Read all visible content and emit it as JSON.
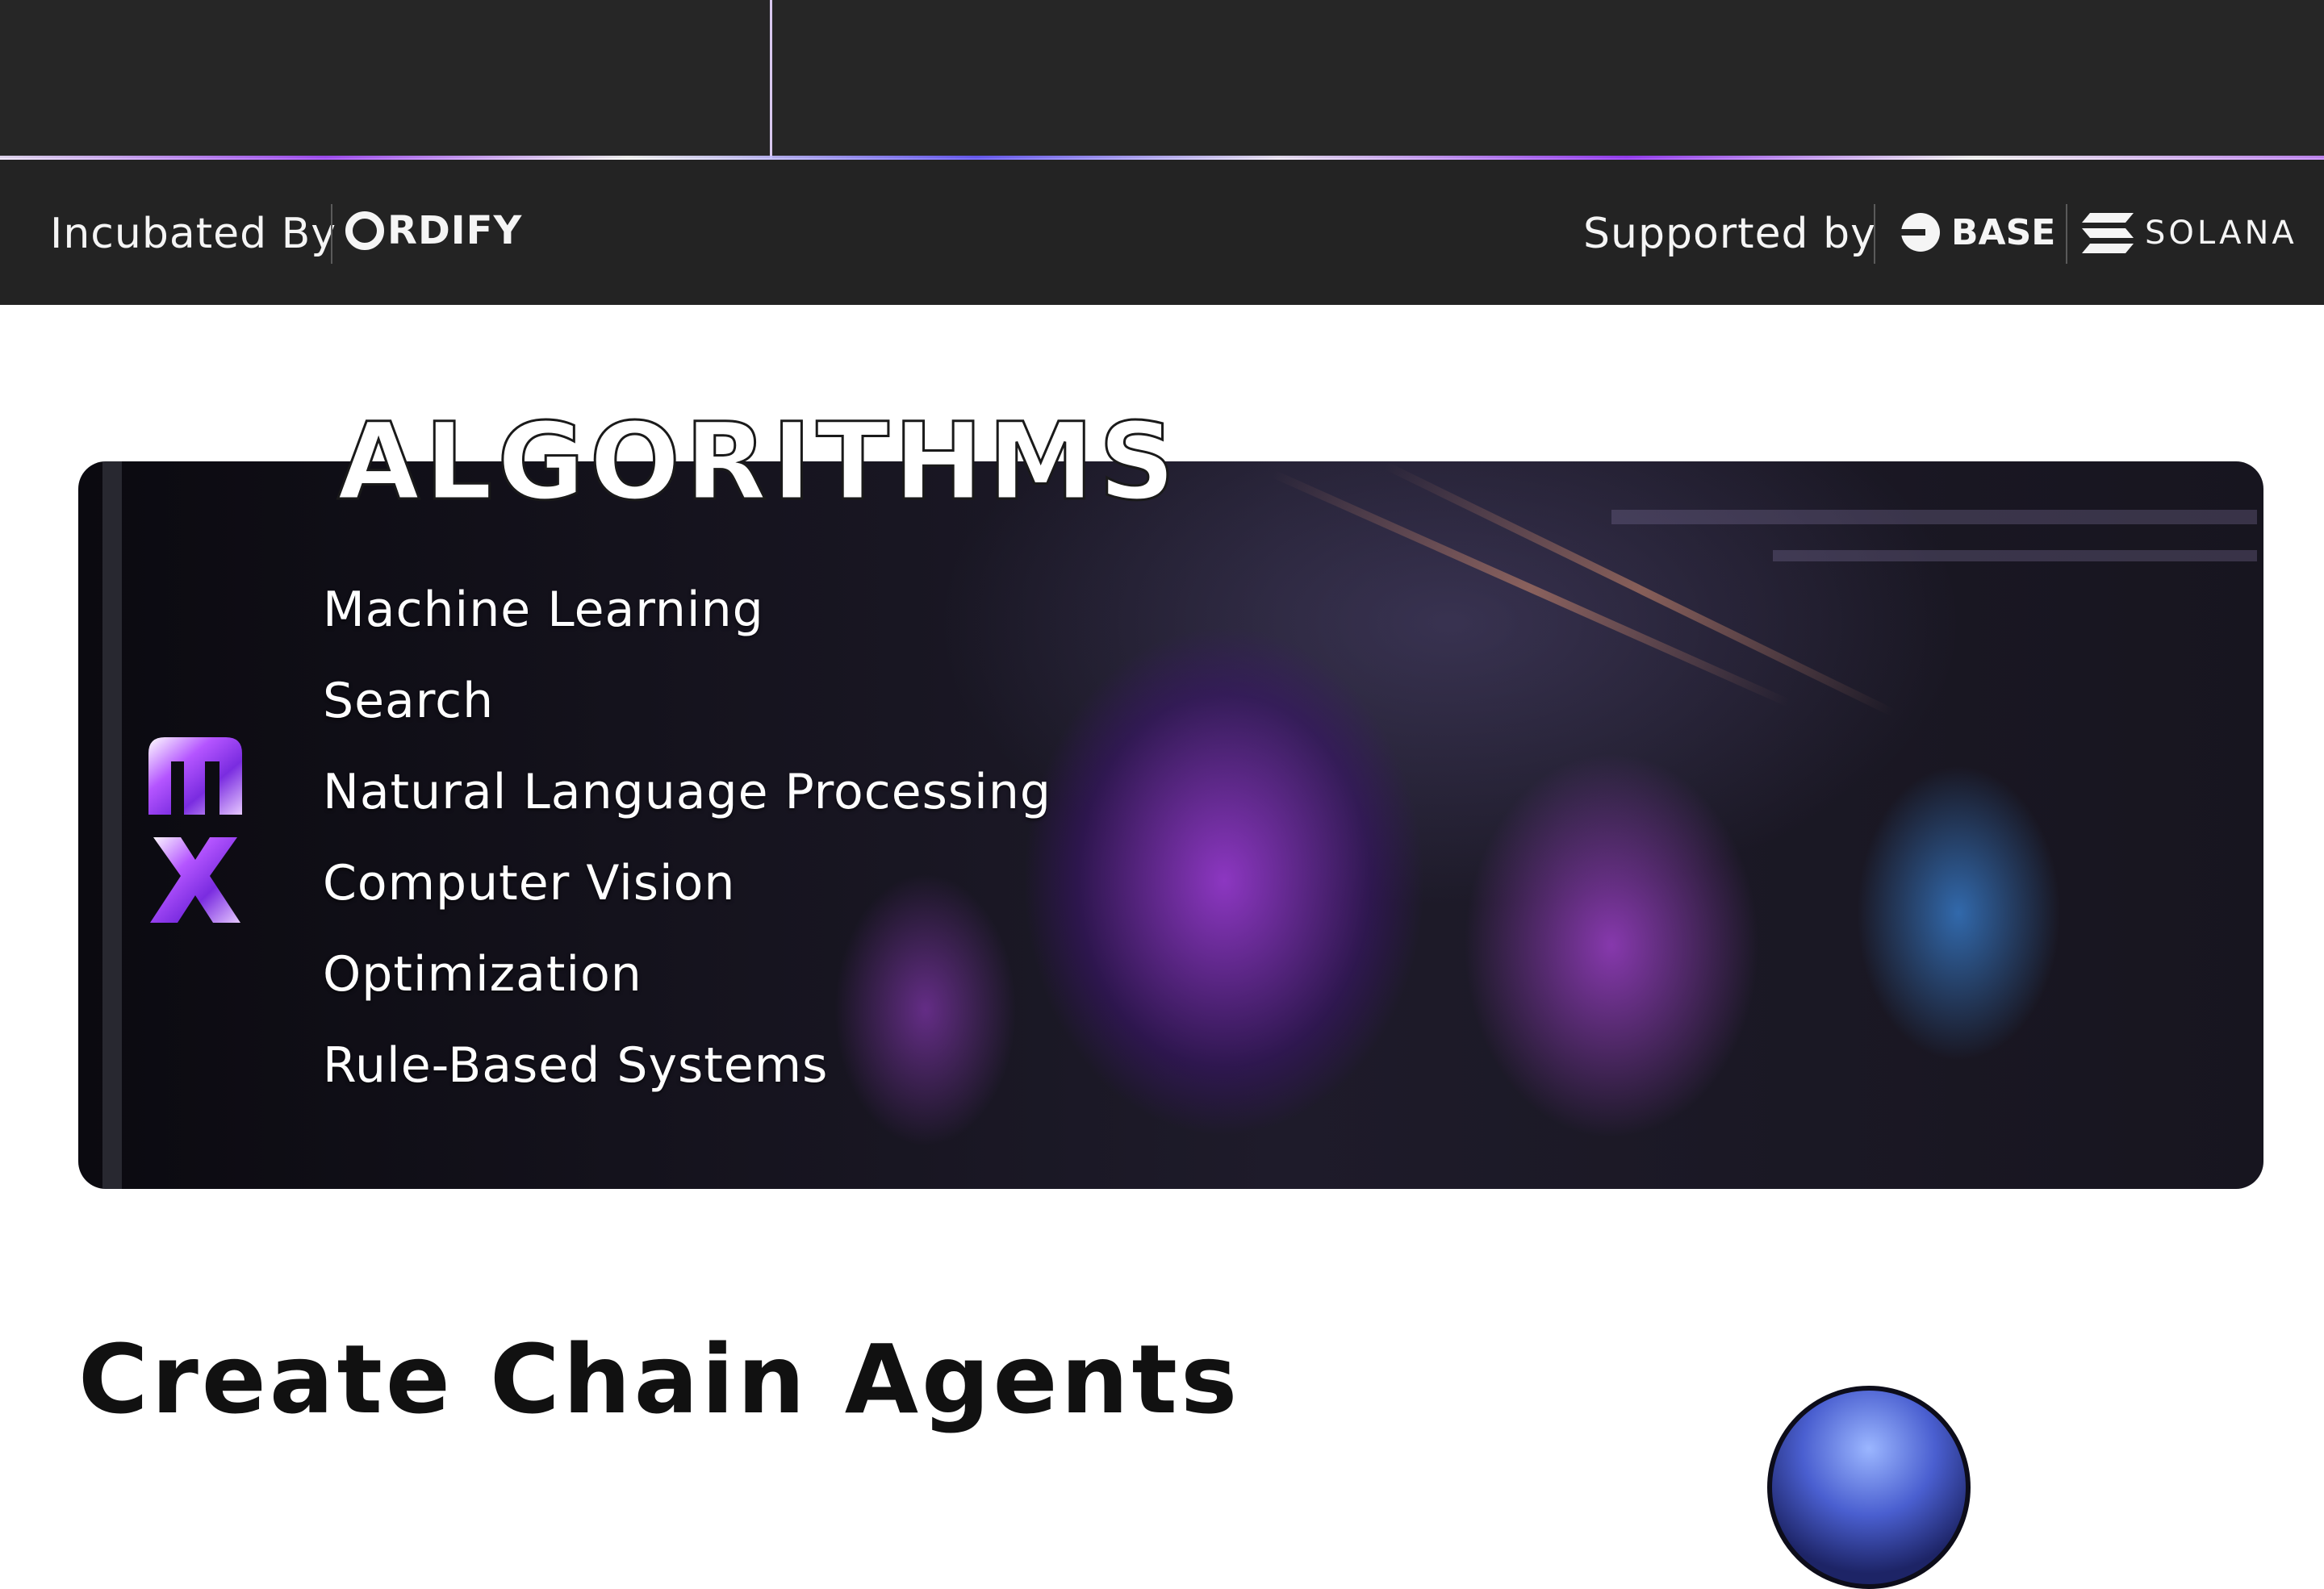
{
  "partners": {
    "incubated_label": "Incubated By",
    "incubator_logo_text": "RDIFY",
    "supported_label": "Supported by",
    "base_logo_text": "BASE",
    "solana_logo_text": "SOLANA"
  },
  "algorithms": {
    "title": "ALGORITHMS",
    "items": [
      "Machine Learning",
      "Search",
      "Natural Language Processing",
      "Computer Vision",
      "Optimization",
      "Rule-Based Systems"
    ]
  },
  "next_section": {
    "title": "Create Chain Agents"
  },
  "colors": {
    "bar_background": "#232323",
    "accent_purple": "#a64dff"
  }
}
